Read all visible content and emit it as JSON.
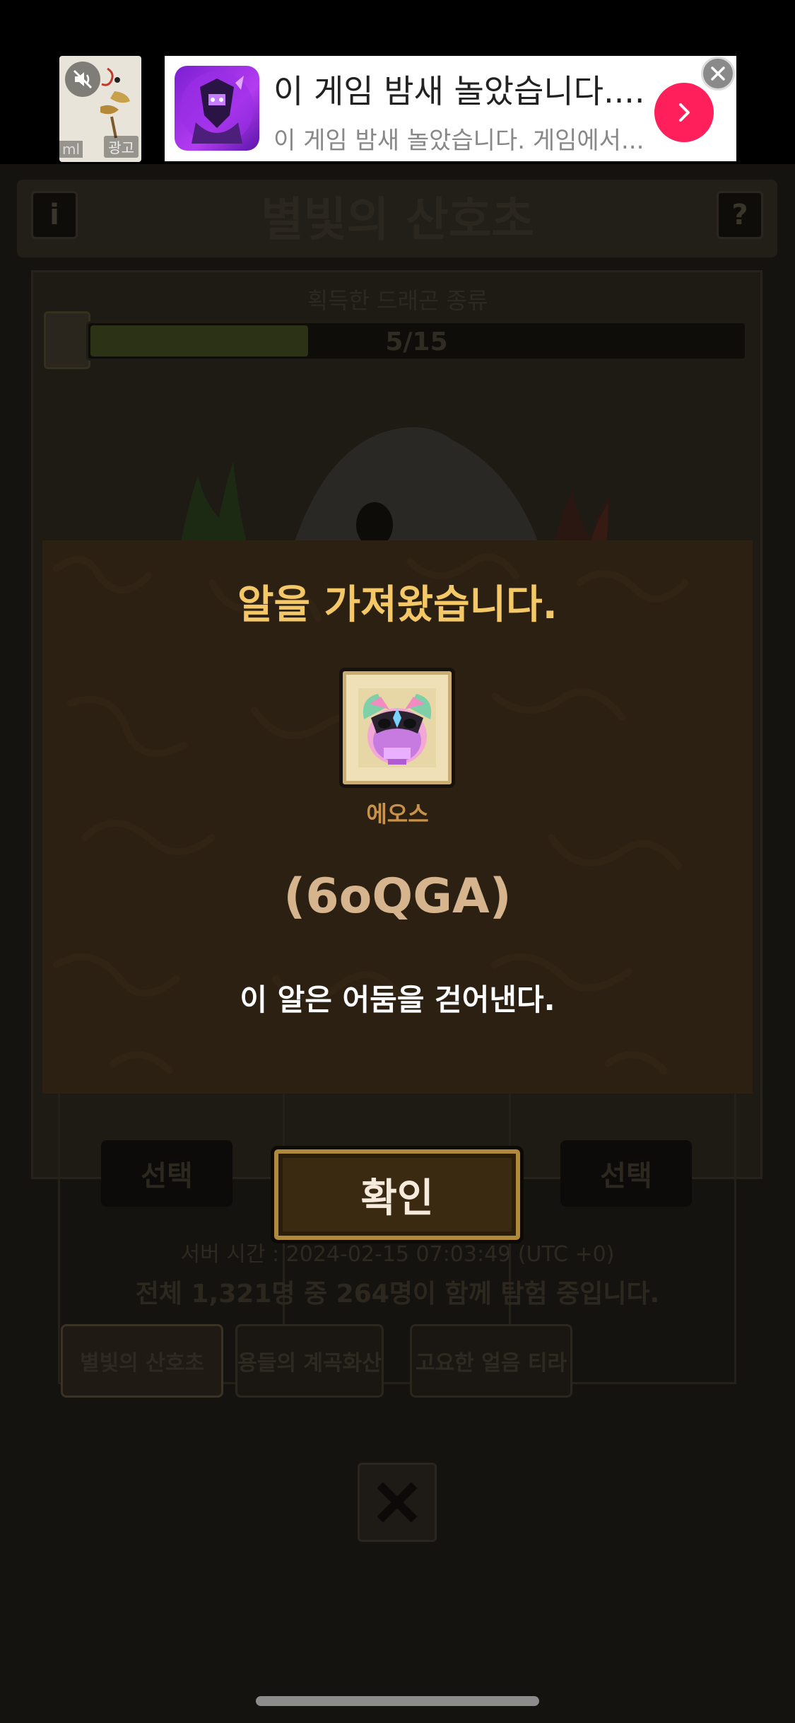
{
  "ad": {
    "thumb_tag": "광고",
    "thumb_tag_left": "ml",
    "title": "이 게임 밤새 놀았습니다....",
    "subtitle": "이 게임 밤새 놀았습니다. 게임에서...",
    "go_icon": "chevron-right-icon",
    "close_icon": "close-icon",
    "mute_icon": "mute-icon",
    "accent_color": "#ff1f5a"
  },
  "game": {
    "title": "별빛의 산호초",
    "info_button": "i",
    "help_button": "?",
    "progress": {
      "label": "획득한 드래곤 종류",
      "text": "5/15",
      "value": 5,
      "max": 15
    },
    "slots": {
      "select_left": "선택",
      "select_right": "선택"
    },
    "server_time": "서버 시간 : 2024-02-15 07:03:49 (UTC +0)",
    "players": "전체 1,321명 중 264명이 함께 탐험 중입니다.",
    "zones": [
      {
        "label": "별빛의 산호초"
      },
      {
        "label": "용들의 계곡화산"
      },
      {
        "label": "고요한 얼음 티라"
      }
    ],
    "close_icon": "close-x-icon"
  },
  "modal": {
    "title": "알을 가져왔습니다.",
    "egg_name": "에오스",
    "egg_code": "(6oQGA)",
    "egg_description": "이 알은 어둠을 걷어낸다.",
    "confirm_label": "확인",
    "title_color": "#f4c867",
    "background_color": "#2c2013"
  }
}
